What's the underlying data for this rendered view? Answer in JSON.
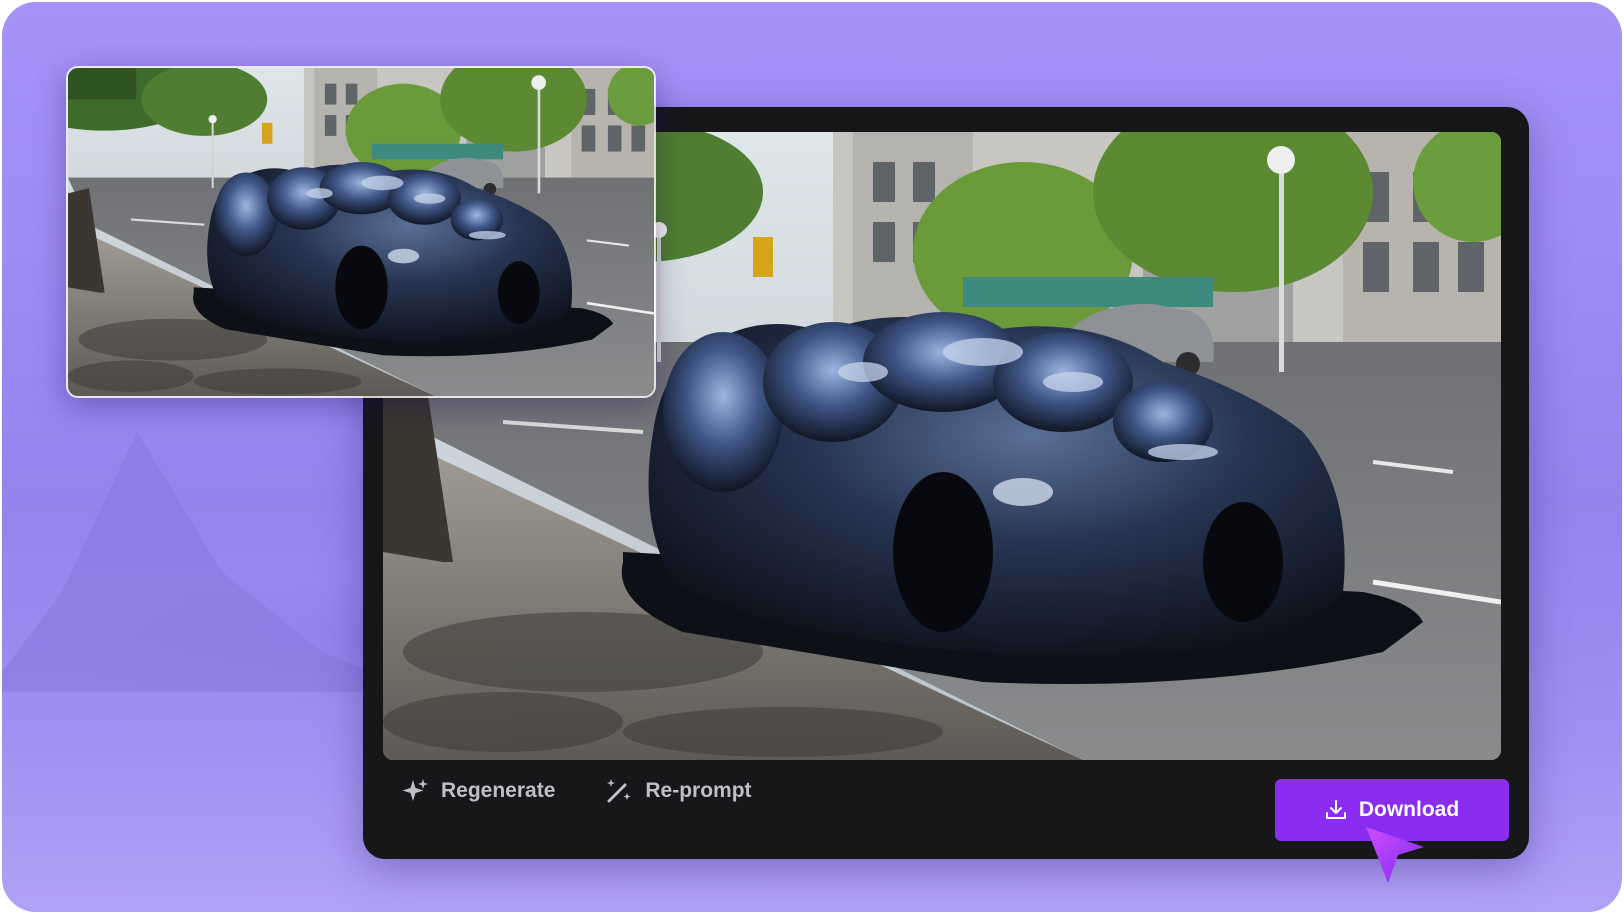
{
  "actions": {
    "regenerate_label": "Regenerate",
    "reprompt_label": "Re-prompt",
    "download_label": "Download"
  },
  "icons": {
    "regenerate": "sparkle-icon",
    "reprompt": "magic-wand-icon",
    "download": "download-icon",
    "cursor": "pointer-cursor-icon"
  },
  "colors": {
    "accent": "#8a2cf2",
    "panel": "#17171a",
    "background": "#9d8bf3",
    "action_text": "#bfbfc8"
  }
}
